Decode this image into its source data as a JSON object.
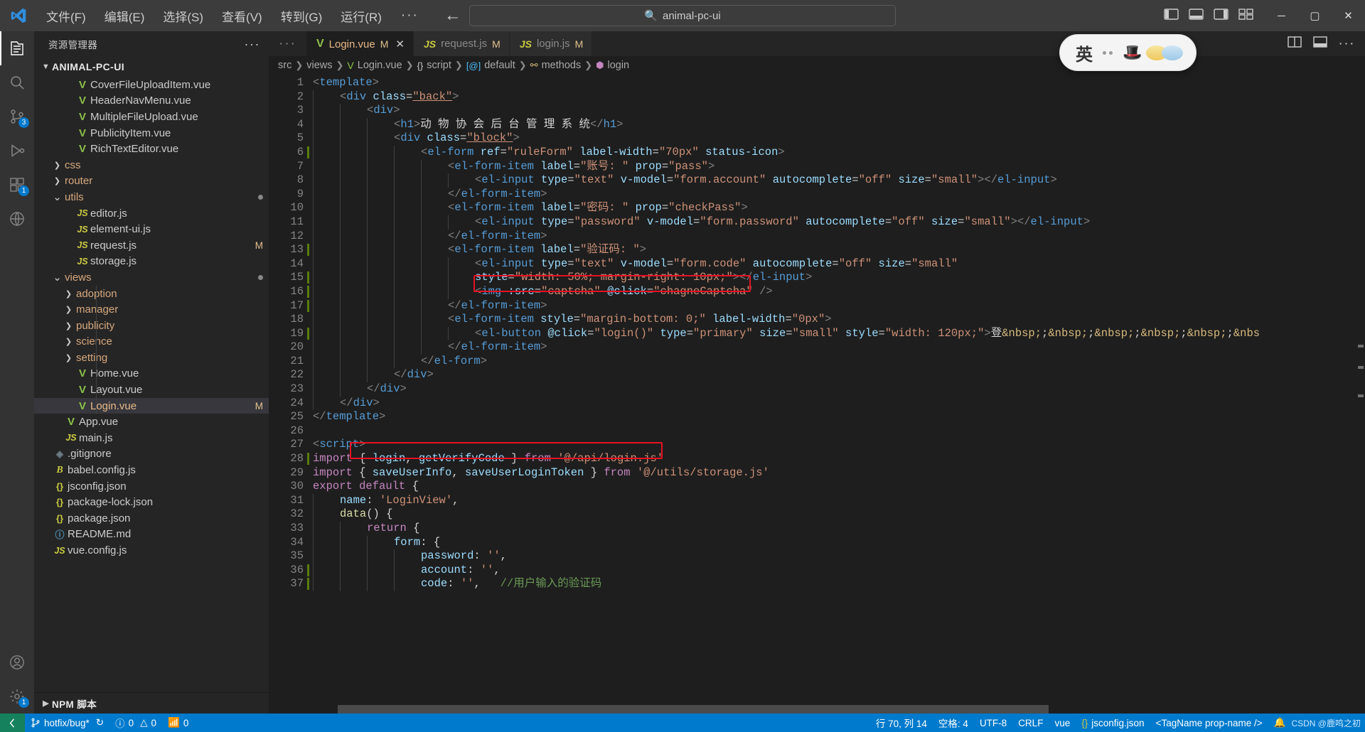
{
  "titlebar": {
    "logo_icon": "vscode-logo",
    "menus": [
      "文件(F)",
      "编辑(E)",
      "选择(S)",
      "查看(V)",
      "转到(G)",
      "运行(R)"
    ],
    "more_label": "···",
    "back_icon": "arrow-left-icon",
    "forward_icon": "arrow-right-icon",
    "search": {
      "value": "animal-pc-ui",
      "icon": "search-icon"
    },
    "layout_icons": [
      "toggle-primary-sidebar-icon",
      "toggle-panel-icon",
      "toggle-secondary-sidebar-icon",
      "customize-layout-icon"
    ],
    "window_buttons": {
      "minimize": "─",
      "maximize": "▢",
      "close": "✕"
    }
  },
  "activitybar": {
    "items": [
      {
        "name": "explorer",
        "icon": "files-icon",
        "badge": ""
      },
      {
        "name": "search",
        "icon": "search-icon",
        "badge": ""
      },
      {
        "name": "source-control",
        "icon": "source-control-icon",
        "badge": "3"
      },
      {
        "name": "run-and-debug",
        "icon": "debug-icon",
        "badge": ""
      },
      {
        "name": "extensions",
        "icon": "extensions-icon",
        "badge": "1"
      },
      {
        "name": "remote-explorer",
        "icon": "remote-explorer-icon",
        "badge": ""
      }
    ],
    "bottom": [
      {
        "name": "accounts",
        "icon": "account-icon",
        "badge": ""
      },
      {
        "name": "settings",
        "icon": "gear-icon",
        "badge": "1"
      }
    ]
  },
  "sidebar": {
    "title": "资源管理器",
    "more_actions": "···",
    "root": {
      "label": "ANIMAL-PC-UI",
      "chevron": "chevron-down-icon"
    },
    "tree": [
      {
        "indent": 2,
        "chev": "",
        "icon": "vue",
        "label": "CoverFileUploadItem.vue",
        "flag": ""
      },
      {
        "indent": 2,
        "chev": "",
        "icon": "vue",
        "label": "HeaderNavMenu.vue",
        "flag": ""
      },
      {
        "indent": 2,
        "chev": "",
        "icon": "vue",
        "label": "MultipleFileUpload.vue",
        "flag": ""
      },
      {
        "indent": 2,
        "chev": "",
        "icon": "vue",
        "label": "PublicityItem.vue",
        "flag": ""
      },
      {
        "indent": 2,
        "chev": "",
        "icon": "vue",
        "label": "RichTextEditor.vue",
        "flag": ""
      },
      {
        "indent": 1,
        "chev": "right",
        "icon": "",
        "label": "css",
        "flag": "",
        "folder": true
      },
      {
        "indent": 1,
        "chev": "right",
        "icon": "",
        "label": "router",
        "flag": "",
        "folder": true
      },
      {
        "indent": 1,
        "chev": "down",
        "icon": "",
        "label": "utils",
        "flag": "dot",
        "folder": true
      },
      {
        "indent": 2,
        "chev": "",
        "icon": "js",
        "label": "editor.js",
        "flag": ""
      },
      {
        "indent": 2,
        "chev": "",
        "icon": "js",
        "label": "element-ui.js",
        "flag": ""
      },
      {
        "indent": 2,
        "chev": "",
        "icon": "js",
        "label": "request.js",
        "flag": "M"
      },
      {
        "indent": 2,
        "chev": "",
        "icon": "js",
        "label": "storage.js",
        "flag": ""
      },
      {
        "indent": 1,
        "chev": "down",
        "icon": "",
        "label": "views",
        "flag": "dot",
        "folder": true
      },
      {
        "indent": 2,
        "chev": "right",
        "icon": "",
        "label": "adoption",
        "flag": "",
        "folder": true
      },
      {
        "indent": 2,
        "chev": "right",
        "icon": "",
        "label": "manager",
        "flag": "",
        "folder": true
      },
      {
        "indent": 2,
        "chev": "right",
        "icon": "",
        "label": "publicity",
        "flag": "",
        "folder": true
      },
      {
        "indent": 2,
        "chev": "right",
        "icon": "",
        "label": "science",
        "flag": "",
        "folder": true
      },
      {
        "indent": 2,
        "chev": "right",
        "icon": "",
        "label": "setting",
        "flag": "",
        "folder": true
      },
      {
        "indent": 2,
        "chev": "",
        "icon": "vue",
        "label": "Home.vue",
        "flag": ""
      },
      {
        "indent": 2,
        "chev": "",
        "icon": "vue",
        "label": "Layout.vue",
        "flag": ""
      },
      {
        "indent": 2,
        "chev": "",
        "icon": "vue",
        "label": "Login.vue",
        "flag": "M",
        "selected": true
      },
      {
        "indent": 1,
        "chev": "",
        "icon": "vue",
        "label": "App.vue",
        "flag": ""
      },
      {
        "indent": 1,
        "chev": "",
        "icon": "js",
        "label": "main.js",
        "flag": ""
      },
      {
        "indent": 0,
        "chev": "",
        "icon": "git",
        "label": ".gitignore",
        "flag": ""
      },
      {
        "indent": 0,
        "chev": "",
        "icon": "babel",
        "label": "babel.config.js",
        "flag": ""
      },
      {
        "indent": 0,
        "chev": "",
        "icon": "json",
        "label": "jsconfig.json",
        "flag": ""
      },
      {
        "indent": 0,
        "chev": "",
        "icon": "json",
        "label": "package-lock.json",
        "flag": ""
      },
      {
        "indent": 0,
        "chev": "",
        "icon": "json",
        "label": "package.json",
        "flag": ""
      },
      {
        "indent": 0,
        "chev": "",
        "icon": "md",
        "label": "README.md",
        "flag": ""
      },
      {
        "indent": 0,
        "chev": "",
        "icon": "js",
        "label": "vue.config.js",
        "flag": ""
      }
    ],
    "npm_section": {
      "label": "NPM 脚本",
      "chevron": "chevron-right-icon"
    }
  },
  "editor": {
    "tabs": [
      {
        "label": "Login.vue",
        "icon": "vue",
        "dirty": "M",
        "active": true,
        "close": "✕"
      },
      {
        "label": "request.js",
        "icon": "js",
        "dirty": "M",
        "active": false,
        "close": ""
      },
      {
        "label": "login.js",
        "icon": "js",
        "dirty": "M",
        "active": false,
        "close": ""
      }
    ],
    "tab_overflow": "···",
    "tab_actions": [
      "split-editor-icon",
      "more-actions-icon"
    ],
    "breadcrumb": [
      {
        "label": "src",
        "icon": ""
      },
      {
        "label": "views",
        "icon": ""
      },
      {
        "label": "Login.vue",
        "icon": "vue"
      },
      {
        "label": "script",
        "icon": "brace"
      },
      {
        "label": "default",
        "icon": "at"
      },
      {
        "label": "methods",
        "icon": "wr"
      },
      {
        "label": "login",
        "icon": "cube"
      }
    ],
    "code_lines": [
      {
        "n": 1,
        "indent": 0,
        "git": false,
        "html": "<span class='t-br'>&lt;</span><span class='t-tag'>template</span><span class='t-br'>&gt;</span>"
      },
      {
        "n": 2,
        "indent": 1,
        "git": false,
        "html": "<span class='t-br'>&lt;</span><span class='t-tag'>div</span> <span class='t-attr'>class</span><span class='t-eq'>=</span><span class='u-str'>\"back\"</span><span class='t-br'>&gt;</span>"
      },
      {
        "n": 3,
        "indent": 2,
        "git": false,
        "html": "<span class='t-br'>&lt;</span><span class='t-tag'>div</span><span class='t-br'>&gt;</span>"
      },
      {
        "n": 4,
        "indent": 3,
        "git": false,
        "html": "<span class='t-br'>&lt;</span><span class='t-tag'>h1</span><span class='t-br'>&gt;</span><span class='t-plain'>动 物 协 会 后 台 管 理 系 统</span><span class='t-br'>&lt;/</span><span class='t-tag'>h1</span><span class='t-br'>&gt;</span>"
      },
      {
        "n": 5,
        "indent": 3,
        "git": false,
        "html": "<span class='t-br'>&lt;</span><span class='t-tag'>div</span> <span class='t-attr'>class</span><span class='t-eq'>=</span><span class='u-str'>\"block\"</span><span class='t-br'>&gt;</span>"
      },
      {
        "n": 6,
        "indent": 4,
        "git": true,
        "html": "<span class='t-br'>&lt;</span><span class='t-tag'>el-form</span> <span class='t-attr'>ref</span><span class='t-eq'>=</span><span class='t-str'>\"ruleForm\"</span> <span class='t-attr'>label-width</span><span class='t-eq'>=</span><span class='t-str'>\"70px\"</span> <span class='t-attr'>status-icon</span><span class='t-br'>&gt;</span>"
      },
      {
        "n": 7,
        "indent": 5,
        "git": false,
        "html": "<span class='t-br'>&lt;</span><span class='t-tag'>el-form-item</span> <span class='t-attr'>label</span><span class='t-eq'>=</span><span class='t-str'>\"账号: \"</span> <span class='t-attr'>prop</span><span class='t-eq'>=</span><span class='t-str'>\"pass\"</span><span class='t-br'>&gt;</span>"
      },
      {
        "n": 8,
        "indent": 6,
        "git": false,
        "html": "<span class='t-br'>&lt;</span><span class='t-tag'>el-input</span> <span class='t-attr'>type</span><span class='t-eq'>=</span><span class='t-str'>\"text\"</span> <span class='t-attr'>v-model</span><span class='t-eq'>=</span><span class='t-str'>\"form.account\"</span> <span class='t-attr'>autocomplete</span><span class='t-eq'>=</span><span class='t-str'>\"off\"</span> <span class='t-attr'>size</span><span class='t-eq'>=</span><span class='t-str'>\"small\"</span><span class='t-br'>&gt;&lt;/</span><span class='t-tag'>el-input</span><span class='t-br'>&gt;</span>"
      },
      {
        "n": 9,
        "indent": 5,
        "git": false,
        "html": "<span class='t-br'>&lt;/</span><span class='t-tag'>el-form-item</span><span class='t-br'>&gt;</span>"
      },
      {
        "n": 10,
        "indent": 5,
        "git": false,
        "html": "<span class='t-br'>&lt;</span><span class='t-tag'>el-form-item</span> <span class='t-attr'>label</span><span class='t-eq'>=</span><span class='t-str'>\"密码: \"</span> <span class='t-attr'>prop</span><span class='t-eq'>=</span><span class='t-str'>\"checkPass\"</span><span class='t-br'>&gt;</span>"
      },
      {
        "n": 11,
        "indent": 6,
        "git": false,
        "html": "<span class='t-br'>&lt;</span><span class='t-tag'>el-input</span> <span class='t-attr'>type</span><span class='t-eq'>=</span><span class='t-str'>\"password\"</span> <span class='t-attr'>v-model</span><span class='t-eq'>=</span><span class='t-str'>\"form.password\"</span> <span class='t-attr'>autocomplete</span><span class='t-eq'>=</span><span class='t-str'>\"off\"</span> <span class='t-attr'>size</span><span class='t-eq'>=</span><span class='t-str'>\"small\"</span><span class='t-br'>&gt;&lt;/</span><span class='t-tag'>el-input</span><span class='t-br'>&gt;</span>"
      },
      {
        "n": 12,
        "indent": 5,
        "git": false,
        "html": "<span class='t-br'>&lt;/</span><span class='t-tag'>el-form-item</span><span class='t-br'>&gt;</span>"
      },
      {
        "n": 13,
        "indent": 5,
        "git": true,
        "html": "<span class='t-br'>&lt;</span><span class='t-tag'>el-form-item</span> <span class='t-attr'>label</span><span class='t-eq'>=</span><span class='t-str'>\"验证码: \"</span><span class='t-br'>&gt;</span>"
      },
      {
        "n": 14,
        "indent": 6,
        "git": false,
        "html": "<span class='t-br'>&lt;</span><span class='t-tag'>el-input</span> <span class='t-attr'>type</span><span class='t-eq'>=</span><span class='t-str'>\"text\"</span> <span class='t-attr'>v-model</span><span class='t-eq'>=</span><span class='t-str'>\"form.code\"</span> <span class='t-attr'>autocomplete</span><span class='t-eq'>=</span><span class='t-str'>\"off\"</span> <span class='t-attr'>size</span><span class='t-eq'>=</span><span class='t-str'>\"small\"</span>"
      },
      {
        "n": 15,
        "indent": 6,
        "git": true,
        "html": "<span class='t-attr'>style</span><span class='t-eq'>=</span><span class='t-str'>\"width: 50%; margin-right: 10px;\"</span><span class='t-br'>&gt;&lt;/</span><span class='t-tag'>el-input</span><span class='t-br'>&gt;</span>"
      },
      {
        "n": 16,
        "indent": 6,
        "git": true,
        "html": "<span class='t-br'>&lt;</span><span class='t-tag'>img</span> <span class='t-attr'>:src</span><span class='t-eq'>=</span><span class='t-str'>\"captcha\"</span> <span class='t-attr'>@click</span><span class='t-eq'>=</span><span class='t-str'>\"chagneCaptcha\"</span> <span class='t-br'>/&gt;</span>"
      },
      {
        "n": 17,
        "indent": 5,
        "git": true,
        "html": "<span class='t-br'>&lt;/</span><span class='t-tag'>el-form-item</span><span class='t-br'>&gt;</span>"
      },
      {
        "n": 18,
        "indent": 5,
        "git": false,
        "html": "<span class='t-br'>&lt;</span><span class='t-tag'>el-form-item</span> <span class='t-attr'>style</span><span class='t-eq'>=</span><span class='t-str'>\"margin-bottom: 0;\"</span> <span class='t-attr'>label-width</span><span class='t-eq'>=</span><span class='t-str'>\"0px\"</span><span class='t-br'>&gt;</span>"
      },
      {
        "n": 19,
        "indent": 6,
        "git": true,
        "html": "<span class='t-br'>&lt;</span><span class='t-tag'>el-button</span> <span class='t-attr'>@click</span><span class='t-eq'>=</span><span class='t-str'>\"login()\"</span> <span class='t-attr'>type</span><span class='t-eq'>=</span><span class='t-str'>\"primary\"</span> <span class='t-attr'>size</span><span class='t-eq'>=</span><span class='t-str'>\"small\"</span> <span class='t-attr'>style</span><span class='t-eq'>=</span><span class='t-str'>\"width: 120px;\"</span><span class='t-br'>&gt;</span><span class='t-plain'>登</span><span class='t-ent'>&amp;nbsp;</span><span class='t-plain'>;</span><span class='t-ent'>&amp;nbsp;</span><span class='t-plain'>;</span><span class='t-ent'>&amp;nbsp;</span><span class='t-plain'>;</span><span class='t-ent'>&amp;nbsp;</span><span class='t-plain'>;</span><span class='t-ent'>&amp;nbsp;</span><span class='t-plain'>;</span><span class='t-ent'>&amp;nbs</span>"
      },
      {
        "n": 20,
        "indent": 5,
        "git": false,
        "html": "<span class='t-br'>&lt;/</span><span class='t-tag'>el-form-item</span><span class='t-br'>&gt;</span>"
      },
      {
        "n": 21,
        "indent": 4,
        "git": false,
        "html": "<span class='t-br'>&lt;/</span><span class='t-tag'>el-form</span><span class='t-br'>&gt;</span>"
      },
      {
        "n": 22,
        "indent": 3,
        "git": false,
        "html": "<span class='t-br'>&lt;/</span><span class='t-tag'>div</span><span class='t-br'>&gt;</span>"
      },
      {
        "n": 23,
        "indent": 2,
        "git": false,
        "html": "<span class='t-br'>&lt;/</span><span class='t-tag'>div</span><span class='t-br'>&gt;</span>"
      },
      {
        "n": 24,
        "indent": 1,
        "git": false,
        "html": "<span class='t-br'>&lt;/</span><span class='t-tag'>div</span><span class='t-br'>&gt;</span>"
      },
      {
        "n": 25,
        "indent": 0,
        "git": false,
        "html": "<span class='t-br'>&lt;/</span><span class='t-tag'>template</span><span class='t-br'>&gt;</span>"
      },
      {
        "n": 26,
        "indent": 0,
        "git": false,
        "html": ""
      },
      {
        "n": 27,
        "indent": 0,
        "git": false,
        "html": "<span class='t-br'>&lt;</span><span class='t-tag'>script</span><span class='t-br'>&gt;</span>"
      },
      {
        "n": 28,
        "indent": 0,
        "git": true,
        "html": "<span class='t-kw'>import</span> <span class='t-plain'>{ </span><span class='t-var'>login</span><span class='t-plain'>, </span><span class='t-var'>getVerifyCode</span><span class='t-plain'> }</span> <span class='t-kw'>from</span> <span class='t-str'>'@/api/login.js'</span>"
      },
      {
        "n": 29,
        "indent": 0,
        "git": false,
        "html": "<span class='t-kw'>import</span> <span class='t-plain'>{ </span><span class='t-var'>saveUserInfo</span><span class='t-plain'>, </span><span class='t-var'>saveUserLoginToken</span><span class='t-plain'> }</span> <span class='t-kw'>from</span> <span class='t-str'>'@/utils/storage.js'</span>"
      },
      {
        "n": 30,
        "indent": 0,
        "git": false,
        "html": "<span class='t-kw'>export</span> <span class='t-kw'>default</span> <span class='t-plain'>{</span>"
      },
      {
        "n": 31,
        "indent": 1,
        "git": false,
        "html": "<span class='t-prop'>name</span><span class='t-plain'>: </span><span class='t-str'>'LoginView'</span><span class='t-plain'>,</span>"
      },
      {
        "n": 32,
        "indent": 1,
        "git": false,
        "html": "<span class='t-fn'>data</span><span class='t-plain'>() {</span>"
      },
      {
        "n": 33,
        "indent": 2,
        "git": false,
        "html": "<span class='t-kw'>return</span> <span class='t-plain'>{</span>"
      },
      {
        "n": 34,
        "indent": 3,
        "git": false,
        "html": "<span class='t-prop'>form</span><span class='t-plain'>: {</span>"
      },
      {
        "n": 35,
        "indent": 4,
        "git": false,
        "html": "<span class='t-prop'>password</span><span class='t-plain'>: </span><span class='t-str'>''</span><span class='t-plain'>,</span>"
      },
      {
        "n": 36,
        "indent": 4,
        "git": true,
        "html": "<span class='t-prop'>account</span><span class='t-plain'>: </span><span class='t-str'>''</span><span class='t-plain'>,</span>"
      },
      {
        "n": 37,
        "indent": 4,
        "git": true,
        "html": "<span class='t-prop'>code</span><span class='t-plain'>: </span><span class='t-str'>''</span><span class='t-plain'>,   </span><span class='t-cmt'>//用户输入的验证码</span>"
      }
    ],
    "highlight_boxes": [
      {
        "name": "captcha-img-highlight",
        "line": 16
      },
      {
        "name": "import-login-highlight",
        "line": 28
      }
    ]
  },
  "ime_widget": {
    "lang_label": "英",
    "icons": [
      "ime-dots-icon",
      "ime-hat-icon",
      "ime-cloud-icon",
      "ime-cloud-icon"
    ]
  },
  "statusbar": {
    "remote_icon": "remote-indicator-icon",
    "branch": "hotfix/bug*",
    "sync_icon": "sync-icon",
    "errors": "0",
    "warnings": "0",
    "ports": "0",
    "cursor": "行 70, 列 14",
    "indent": "空格: 4",
    "encoding": "UTF-8",
    "eol": "CRLF",
    "language": "vue",
    "json_mode": "jsconfig.json",
    "tag_hint": "<TagName prop-name />",
    "bell_icon": "bell-icon",
    "watermark": "CSDN @鹿鸣之初"
  },
  "colors": {
    "accent": "#007acc",
    "remote_green": "#16825d",
    "highlight_red": "#e81123",
    "vue_green": "#8dc149",
    "js_yellow": "#cbcb41",
    "modified_orange": "#e2c08d"
  }
}
